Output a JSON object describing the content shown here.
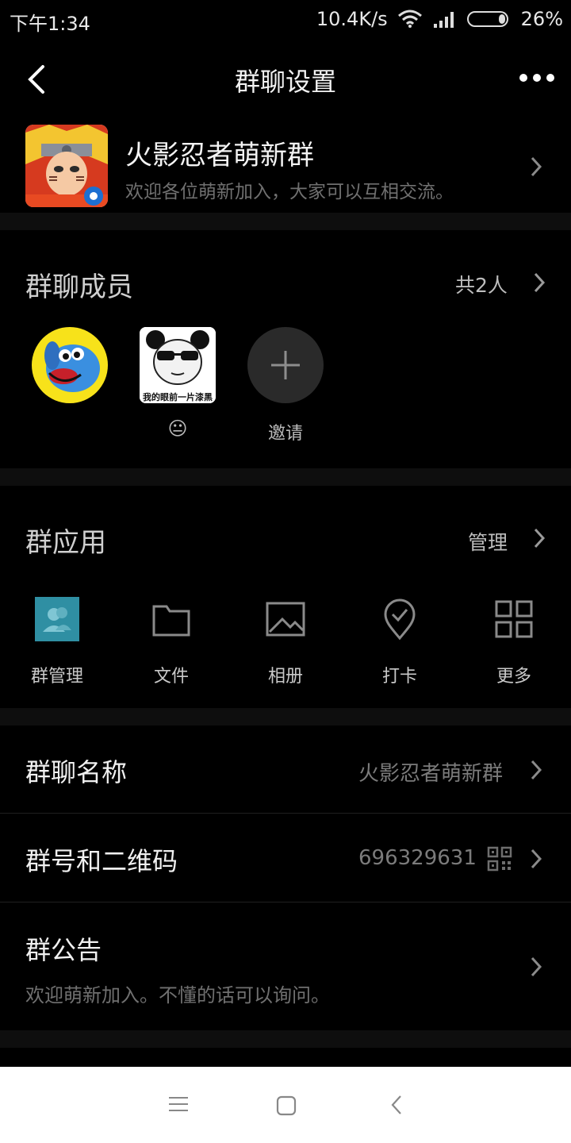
{
  "status_bar": {
    "time": "下午1:34",
    "speed": "10.4K/s",
    "battery": "26%"
  },
  "header": {
    "title": "群聊设置"
  },
  "group": {
    "name": "火影忍者萌新群",
    "description": "欢迎各位萌新加入，大家可以互相交流。"
  },
  "members": {
    "title": "群聊成员",
    "count": "共2人",
    "items": [
      {
        "label": ""
      },
      {
        "label": "😐",
        "meme_caption": "我的眼前一片漆黑"
      },
      {
        "label": "邀请"
      }
    ]
  },
  "apps": {
    "title": "群应用",
    "manage": "管理",
    "items": [
      {
        "label": "群管理",
        "icon": "group-manage-icon"
      },
      {
        "label": "文件",
        "icon": "folder-icon"
      },
      {
        "label": "相册",
        "icon": "image-icon"
      },
      {
        "label": "打卡",
        "icon": "checkin-icon"
      },
      {
        "label": "更多",
        "icon": "grid-icon"
      }
    ]
  },
  "settings": {
    "name_label": "群聊名称",
    "name_value": "火影忍者萌新群",
    "number_label": "群号和二维码",
    "number_value": "696329631",
    "notice_label": "群公告",
    "notice_value": "欢迎萌新加入。不懂的话可以询问。"
  },
  "colors": {
    "background": "#000000",
    "accent_app": "#2f8fa3",
    "nav_bar": "#ffffff"
  }
}
